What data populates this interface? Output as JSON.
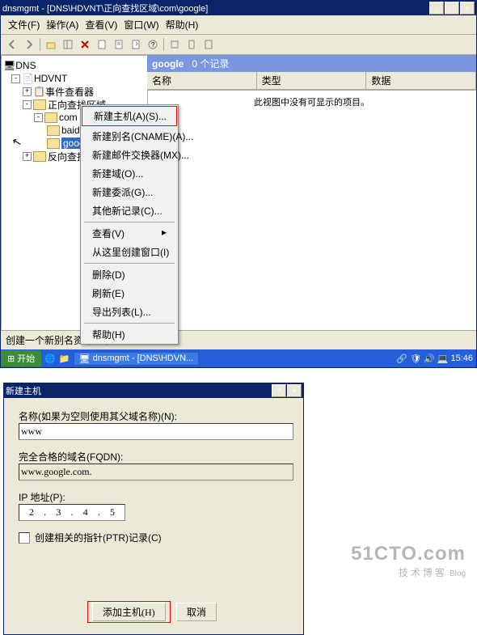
{
  "window": {
    "title": "dnsmgmt - [DNS\\HDVNT\\正向查找区域\\com\\google]",
    "min": "_",
    "max": "□",
    "close": "×"
  },
  "menu": {
    "file": "文件(F)",
    "action": "操作(A)",
    "view": "查看(V)",
    "window": "窗口(W)",
    "help": "帮助(H)"
  },
  "tree": {
    "root": "DNS",
    "srv": "HDVNT",
    "viewer": "事件查看器",
    "fwd": "正向查找区域",
    "com": "com",
    "baidu": "baidu",
    "google": "google",
    "rev": "反向查找"
  },
  "pathbar": {
    "zone": "google",
    "count": "0 个记录"
  },
  "cols": {
    "name": "名称",
    "type": "类型",
    "data": "数据"
  },
  "list": {
    "empty": "此视图中没有可显示的项目。"
  },
  "ctx": {
    "new_a": "新建主机(A)(S)...",
    "new_cname": "新建别名(CNAME)(A)...",
    "new_mx": "新建邮件交换器(MX)...",
    "new_domain": "新建域(O)...",
    "new_deleg": "新建委派(G)...",
    "new_other": "其他新记录(C)...",
    "view": "查看(V)",
    "new_win": "从这里创建窗口(I)",
    "delete": "删除(D)",
    "refresh": "刷新(E)",
    "export": "导出列表(L)...",
    "help": "帮助(H)"
  },
  "status": {
    "msg": "创建一个新别名资源记录。"
  },
  "taskbar": {
    "start": "开始",
    "task": "dnsmgmt - [DNS\\HDVN...",
    "time": "15:46"
  },
  "dialog": {
    "title": "新建主机",
    "help": "?",
    "close": "×",
    "name_label": "名称(如果为空则使用其父域名称)(N):",
    "name_value": "www",
    "fqdn_label": "完全合格的域名(FQDN):",
    "fqdn_value": "www.google.com.",
    "ip_label": "IP 地址(P):",
    "ip1": "2",
    "ip2": "3",
    "ip3": "4",
    "ip4": "5",
    "ptr_label": "创建相关的指针(PTR)记录(C)",
    "add": "添加主机(H)",
    "cancel": "取消"
  },
  "watermark": {
    "brand": "51CTO.com",
    "sub": "技术博客",
    "blog": "Blog"
  }
}
